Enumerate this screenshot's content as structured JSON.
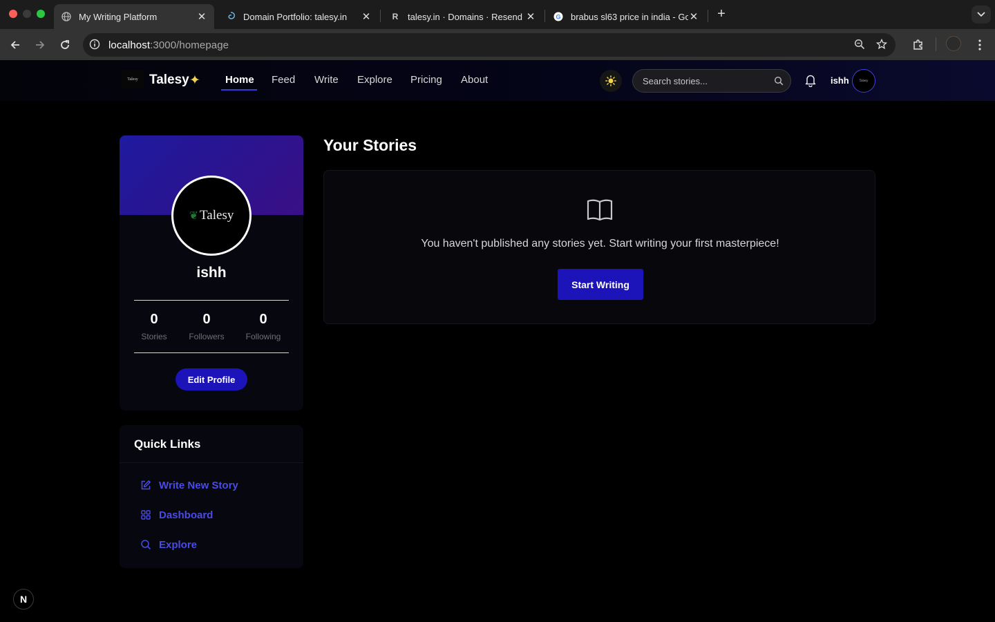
{
  "browser": {
    "tabs": [
      {
        "title": "My Writing Platform",
        "favicon": "globe-icon",
        "active": true
      },
      {
        "title": "Domain Portfolio: talesy.in",
        "favicon": "swirl-icon",
        "active": false
      },
      {
        "title": "talesy.in · Domains · Resend",
        "favicon_text": "R",
        "active": false
      },
      {
        "title": "brabus sl63 price in india - Go",
        "favicon": "google-icon",
        "active": false
      }
    ],
    "url": {
      "host": "localhost",
      "rest": ":3000/homepage"
    }
  },
  "header": {
    "logo_text": "Talesy",
    "brand": "Talesy",
    "brand_star": "✦",
    "nav": [
      "Home",
      "Feed",
      "Write",
      "Explore",
      "Pricing",
      "About"
    ],
    "active_nav": "Home",
    "search_placeholder": "Search stories...",
    "username": "ishh",
    "avatar_text": "Talesy"
  },
  "profile": {
    "avatar_logo": "Talesy",
    "name": "ishh",
    "stats": [
      {
        "value": "0",
        "label": "Stories"
      },
      {
        "value": "0",
        "label": "Followers"
      },
      {
        "value": "0",
        "label": "Following"
      }
    ],
    "edit_label": "Edit Profile"
  },
  "quick_links": {
    "title": "Quick Links",
    "items": [
      {
        "label": "Write New Story",
        "icon": "edit-icon"
      },
      {
        "label": "Dashboard",
        "icon": "grid-icon"
      },
      {
        "label": "Explore",
        "icon": "search-icon"
      }
    ]
  },
  "stories": {
    "title": "Your Stories",
    "empty_message": "You haven't published any stories yet. Start writing your first masterpiece!",
    "cta": "Start Writing"
  },
  "dev_badge": "N",
  "colors": {
    "accent": "#1c13b8",
    "link": "#4a4ae6",
    "star": "#f5d34a"
  }
}
